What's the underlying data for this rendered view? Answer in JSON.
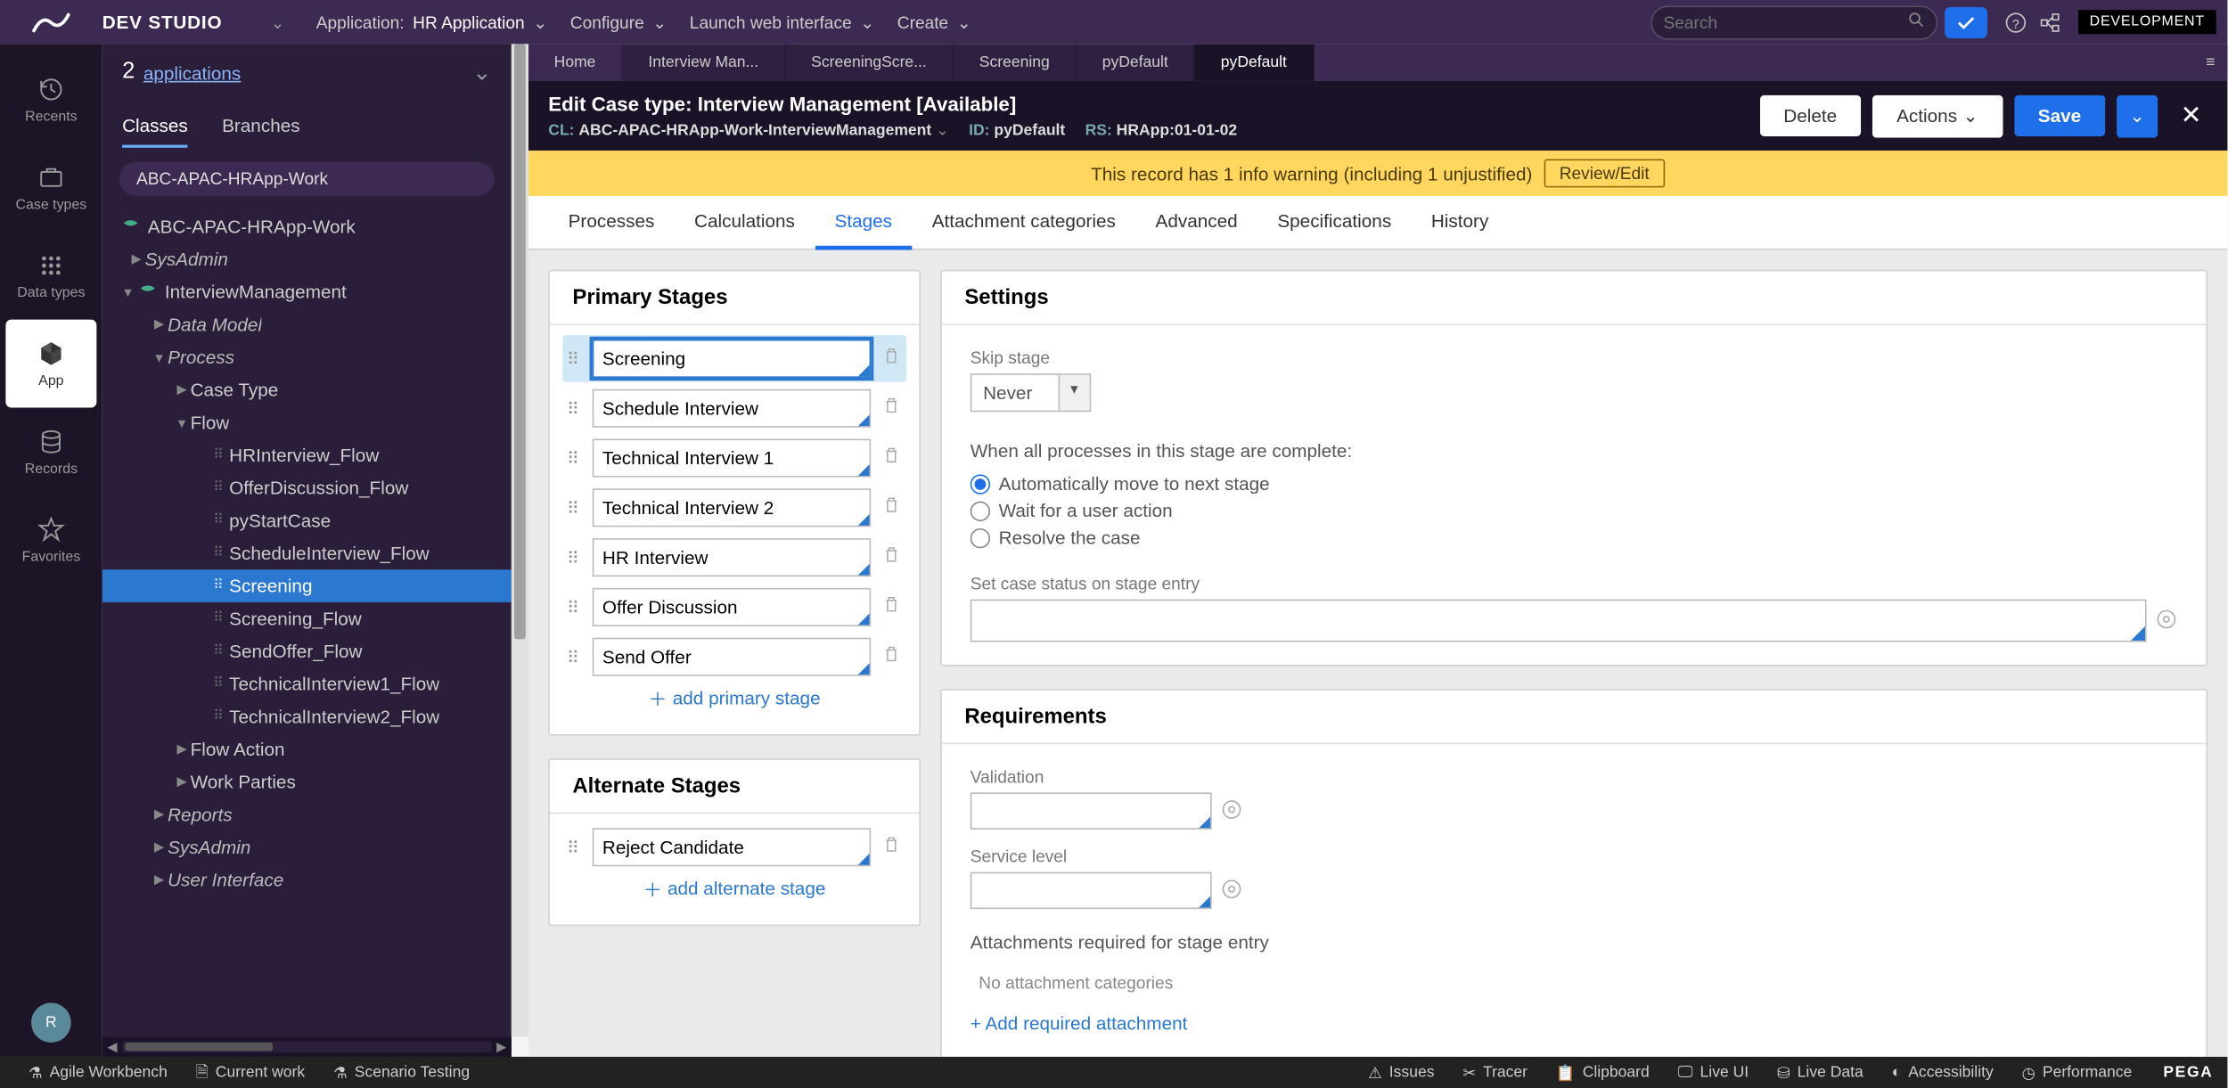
{
  "header": {
    "brand": "DEV STUDIO",
    "app_label": "Application:",
    "app_name": "HR Application",
    "menu_configure": "Configure",
    "menu_launch": "Launch web interface",
    "menu_create": "Create",
    "search_placeholder": "Search",
    "env_badge": "DEVELOPMENT"
  },
  "rail": {
    "recents": "Recents",
    "casetypes": "Case types",
    "datatypes": "Data types",
    "app": "App",
    "records": "Records",
    "favorites": "Favorites",
    "avatar_initial": "R"
  },
  "explorer": {
    "count": "2",
    "apps_link": "applications",
    "tab_classes": "Classes",
    "tab_branches": "Branches",
    "class_input": "ABC-APAC-HRApp-Work",
    "tree": {
      "root": "ABC-APAC-HRApp-Work",
      "sysadmin1": "SysAdmin",
      "interview": "InterviewManagement",
      "datamodel": "Data Model",
      "process": "Process",
      "casetype": "Case Type",
      "flow": "Flow",
      "flows": [
        "HRInterview_Flow",
        "OfferDiscussion_Flow",
        "pyStartCase",
        "ScheduleInterview_Flow",
        "Screening",
        "Screening_Flow",
        "SendOffer_Flow",
        "TechnicalInterview1_Flow",
        "TechnicalInterview2_Flow"
      ],
      "flowaction": "Flow Action",
      "workparties": "Work Parties",
      "reports": "Reports",
      "sysadmin2": "SysAdmin",
      "ui": "User Interface"
    }
  },
  "docTabs": [
    "Home",
    "Interview Man...",
    "ScreeningScre...",
    "Screening",
    "pyDefault",
    "pyDefault"
  ],
  "editHeader": {
    "prefix": "Edit  Case type:",
    "name": "Interview Management [Available]",
    "cl_label": "CL:",
    "cl_value": "ABC-APAC-HRApp-Work-InterviewManagement",
    "id_label": "ID:",
    "id_value": "pyDefault",
    "rs_label": "RS:",
    "rs_value": "HRApp:01-01-02",
    "btn_delete": "Delete",
    "btn_actions": "Actions",
    "btn_save": "Save"
  },
  "banner": {
    "text": "This record has 1 info warning (including 1 unjustified)",
    "review": "Review/Edit"
  },
  "ruleTabs": [
    "Processes",
    "Calculations",
    "Stages",
    "Attachment categories",
    "Advanced",
    "Specifications",
    "History"
  ],
  "stages": {
    "primary_title": "Primary Stages",
    "primary": [
      "Screening",
      "Schedule Interview",
      "Technical Interview 1",
      "Technical Interview 2",
      "HR Interview",
      "Offer Discussion",
      "Send Offer"
    ],
    "add_primary": "add primary stage",
    "alternate_title": "Alternate Stages",
    "alternate": [
      "Reject Candidate"
    ],
    "add_alternate": "add alternate stage"
  },
  "settings": {
    "title": "Settings",
    "skip_label": "Skip stage",
    "skip_value": "Never",
    "when_complete_label": "When all processes in this stage are complete:",
    "opt_auto": "Automatically move to next stage",
    "opt_wait": "Wait for a user action",
    "opt_resolve": "Resolve the case",
    "status_label": "Set case status on stage entry"
  },
  "requirements": {
    "title": "Requirements",
    "validation": "Validation",
    "service_level": "Service level",
    "attachments_label": "Attachments required for stage entry",
    "no_attach": "No attachment categories",
    "add_attach": "+ Add required attachment"
  },
  "footer": {
    "agile": "Agile Workbench",
    "current": "Current work",
    "scenario": "Scenario Testing",
    "issues": "Issues",
    "tracer": "Tracer",
    "clipboard": "Clipboard",
    "liveui": "Live UI",
    "livedata": "Live Data",
    "accessibility": "Accessibility",
    "performance": "Performance",
    "brand": "PEGA"
  }
}
